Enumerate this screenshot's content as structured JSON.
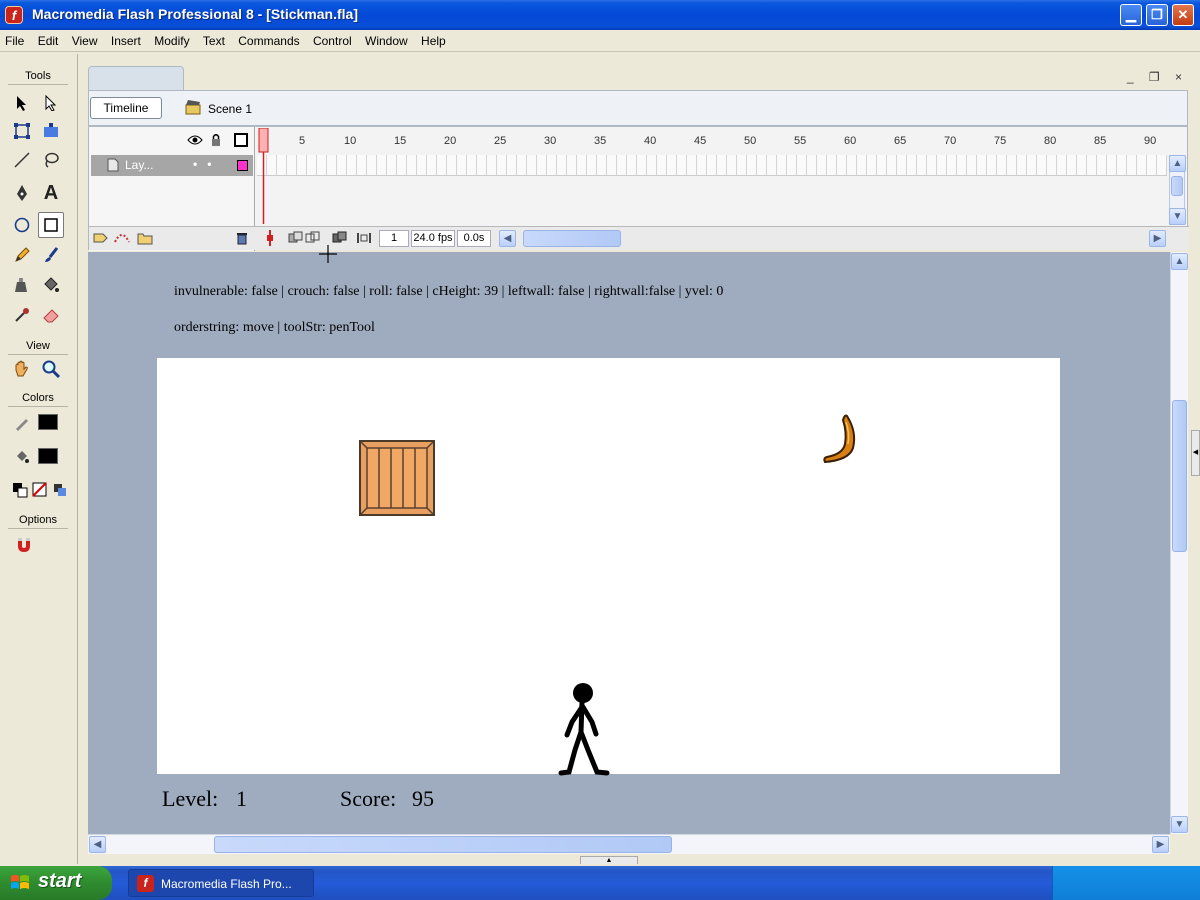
{
  "window": {
    "title": "Macromedia Flash Professional 8 - [Stickman.fla]",
    "app_icon_glyph": "f",
    "controls": [
      "minimize",
      "restore",
      "close"
    ]
  },
  "menu": [
    "File",
    "Edit",
    "View",
    "Insert",
    "Modify",
    "Text",
    "Commands",
    "Control",
    "Window",
    "Help"
  ],
  "tools_panel": {
    "tools_header": "Tools",
    "view_header": "View",
    "colors_header": "Colors",
    "options_header": "Options",
    "text_tool_glyph": "A"
  },
  "document": {
    "timeline_button": "Timeline",
    "scene_label": "Scene 1",
    "doc_controls": "_ ❐ ×"
  },
  "timeline": {
    "ruler_ticks": [
      "1",
      "5",
      "10",
      "15",
      "20",
      "25",
      "30",
      "35",
      "40",
      "45",
      "50",
      "55",
      "60",
      "65",
      "70",
      "75",
      "80",
      "85",
      "90"
    ],
    "layer_name": "Lay...",
    "layer_dots": "•   •",
    "current_frame": "1",
    "frame_rate": "24.0 fps",
    "elapsed_time": "0.0s",
    "layer_color": "#ff33cc"
  },
  "stage": {
    "debug_line1": "invulnerable: false | crouch: false | roll: false | cHeight: 39 | leftwall: false | rightwall:false | yvel: 0",
    "debug_line2": "orderstring: move | toolStr: penTool",
    "level_label": "Level:",
    "level_value": "1",
    "score_label": "Score:",
    "score_value": "95",
    "background_color": "#9facbf"
  },
  "taskbar": {
    "start_label": "start",
    "task_item_label": "Macromedia Flash Pro...",
    "task_item_glyph": "f"
  }
}
